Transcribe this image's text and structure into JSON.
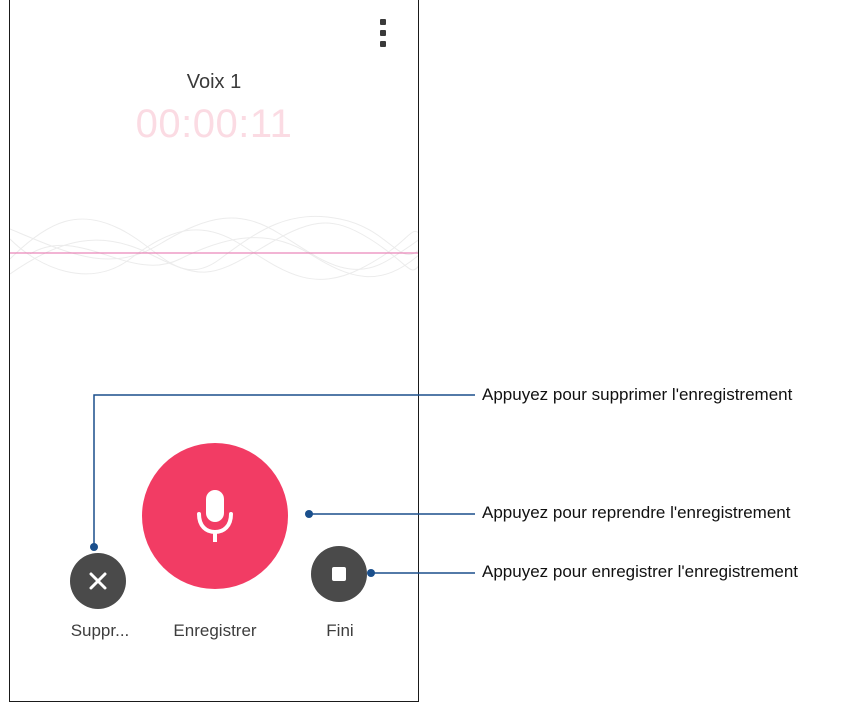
{
  "recorder": {
    "title": "Voix 1",
    "timer": "00:00:11",
    "menu_icon": "more-vert-icon",
    "accent_color": "#f23c64",
    "timer_color": "#fbdbe3",
    "wave_line_color": "#e66aa8"
  },
  "controls": {
    "delete": {
      "label": "Suppr...",
      "icon": "close-icon"
    },
    "record": {
      "label": "Enregistrer",
      "icon": "microphone-icon"
    },
    "done": {
      "label": "Fini",
      "icon": "stop-icon"
    }
  },
  "callouts": {
    "delete": "Appuyez pour supprimer l'enregistrement",
    "resume": "Appuyez pour reprendre l'enregistrement",
    "save": "Appuyez pour enregistrer l'enregistrement",
    "line_color": "#1a4f8c"
  }
}
